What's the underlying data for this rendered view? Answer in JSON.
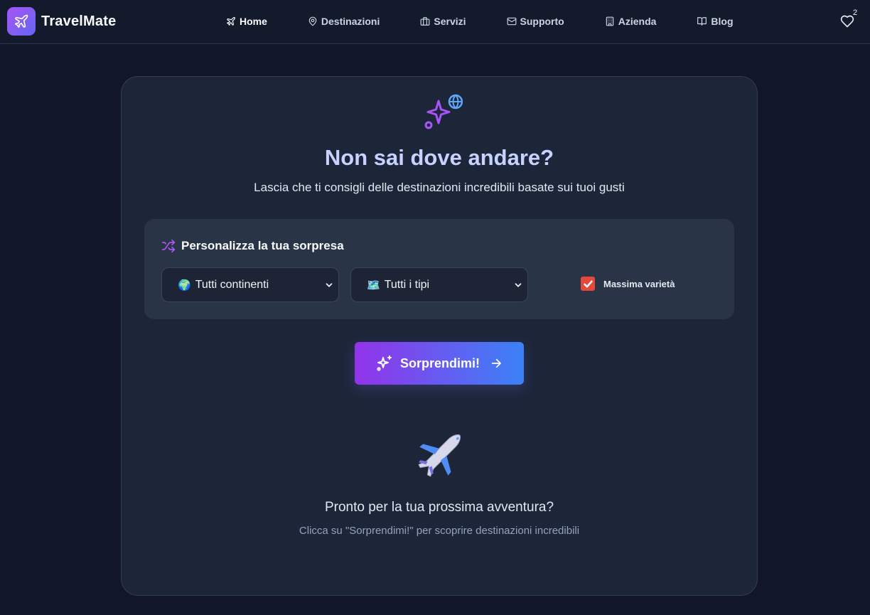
{
  "brand": {
    "name": "TravelMate"
  },
  "nav": {
    "items": [
      {
        "label": "Home",
        "icon": "plane-icon",
        "active": true
      },
      {
        "label": "Destinazioni",
        "icon": "map-pin-icon"
      },
      {
        "label": "Servizi",
        "icon": "briefcase-icon"
      },
      {
        "label": "Supporto",
        "icon": "mail-icon"
      },
      {
        "label": "Azienda",
        "icon": "building-icon"
      },
      {
        "label": "Blog",
        "icon": "book-open-icon"
      }
    ],
    "favorites_count": "2"
  },
  "hero": {
    "title": "Non sai dove andare?",
    "subtitle": "Lascia che ti consigli delle destinazioni incredibili basate sui tuoi gusti"
  },
  "filters": {
    "heading": "Personalizza la tua sorpresa",
    "continent": {
      "emoji": "🌍",
      "selected": "Tutti continenti"
    },
    "type": {
      "emoji": "🗺️",
      "selected": "Tutti i tipi"
    },
    "variety": {
      "label": "Massima varietà",
      "checked": true
    }
  },
  "cta": {
    "label": "Sorprendimi!"
  },
  "empty_state": {
    "emoji": "✈️",
    "title": "Pronto per la tua prossima avventura?",
    "hint": "Clicca su \"Sorprendimi!\" per scoprire destinazioni incredibili"
  },
  "colors": {
    "background": "#111729",
    "card": "#1d2639",
    "accent_purple": "#9333ea",
    "accent_blue": "#3b82f6",
    "checkbox": "#e5483a"
  }
}
